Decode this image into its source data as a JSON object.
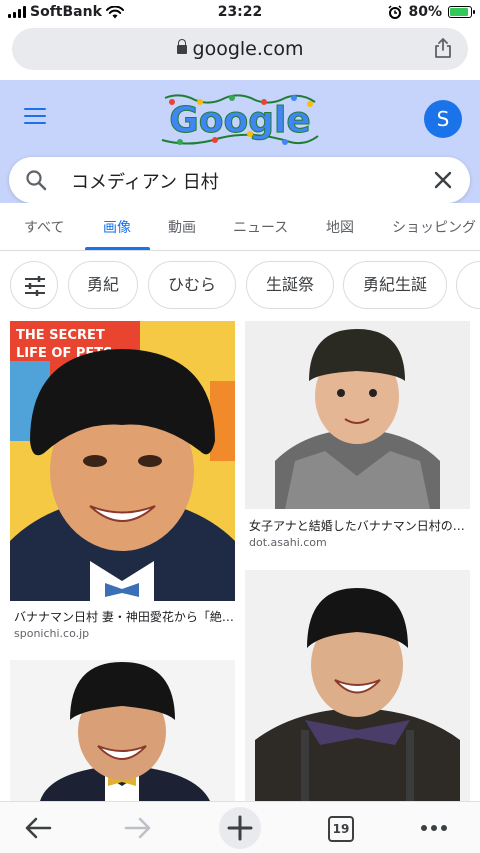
{
  "status_bar": {
    "carrier": "SoftBank",
    "time": "23:22",
    "battery": "80%",
    "battery_level": 0.8
  },
  "browser": {
    "url": "google.com",
    "tab_count": "19"
  },
  "header": {
    "logo": "Google",
    "avatar_letter": "S"
  },
  "search": {
    "query": "コメディアン 日村"
  },
  "tabs": [
    {
      "label": "すべて"
    },
    {
      "label": "画像"
    },
    {
      "label": "動画"
    },
    {
      "label": "ニュース"
    },
    {
      "label": "地図"
    },
    {
      "label": "ショッピング"
    }
  ],
  "chips": [
    {
      "label": "勇紀"
    },
    {
      "label": "ひむら"
    },
    {
      "label": "生誕祭"
    },
    {
      "label": "勇紀生誕"
    }
  ],
  "results": [
    {
      "title": "バナナマン日村 妻・神田愛花から「絶…",
      "source": "sponichi.co.jp"
    },
    {
      "title": "女子アナと結婚したバナナマン日村の…",
      "source": "dot.asahi.com"
    },
    {
      "title": "",
      "source": ""
    },
    {
      "title": "",
      "source": ""
    }
  ],
  "image_text": {
    "poster": "THE SECRET LIFE OF PETS"
  },
  "colors": {
    "accent": "#1a73e8",
    "header_bg": "#c6d3fb",
    "battery": "#34c759"
  }
}
